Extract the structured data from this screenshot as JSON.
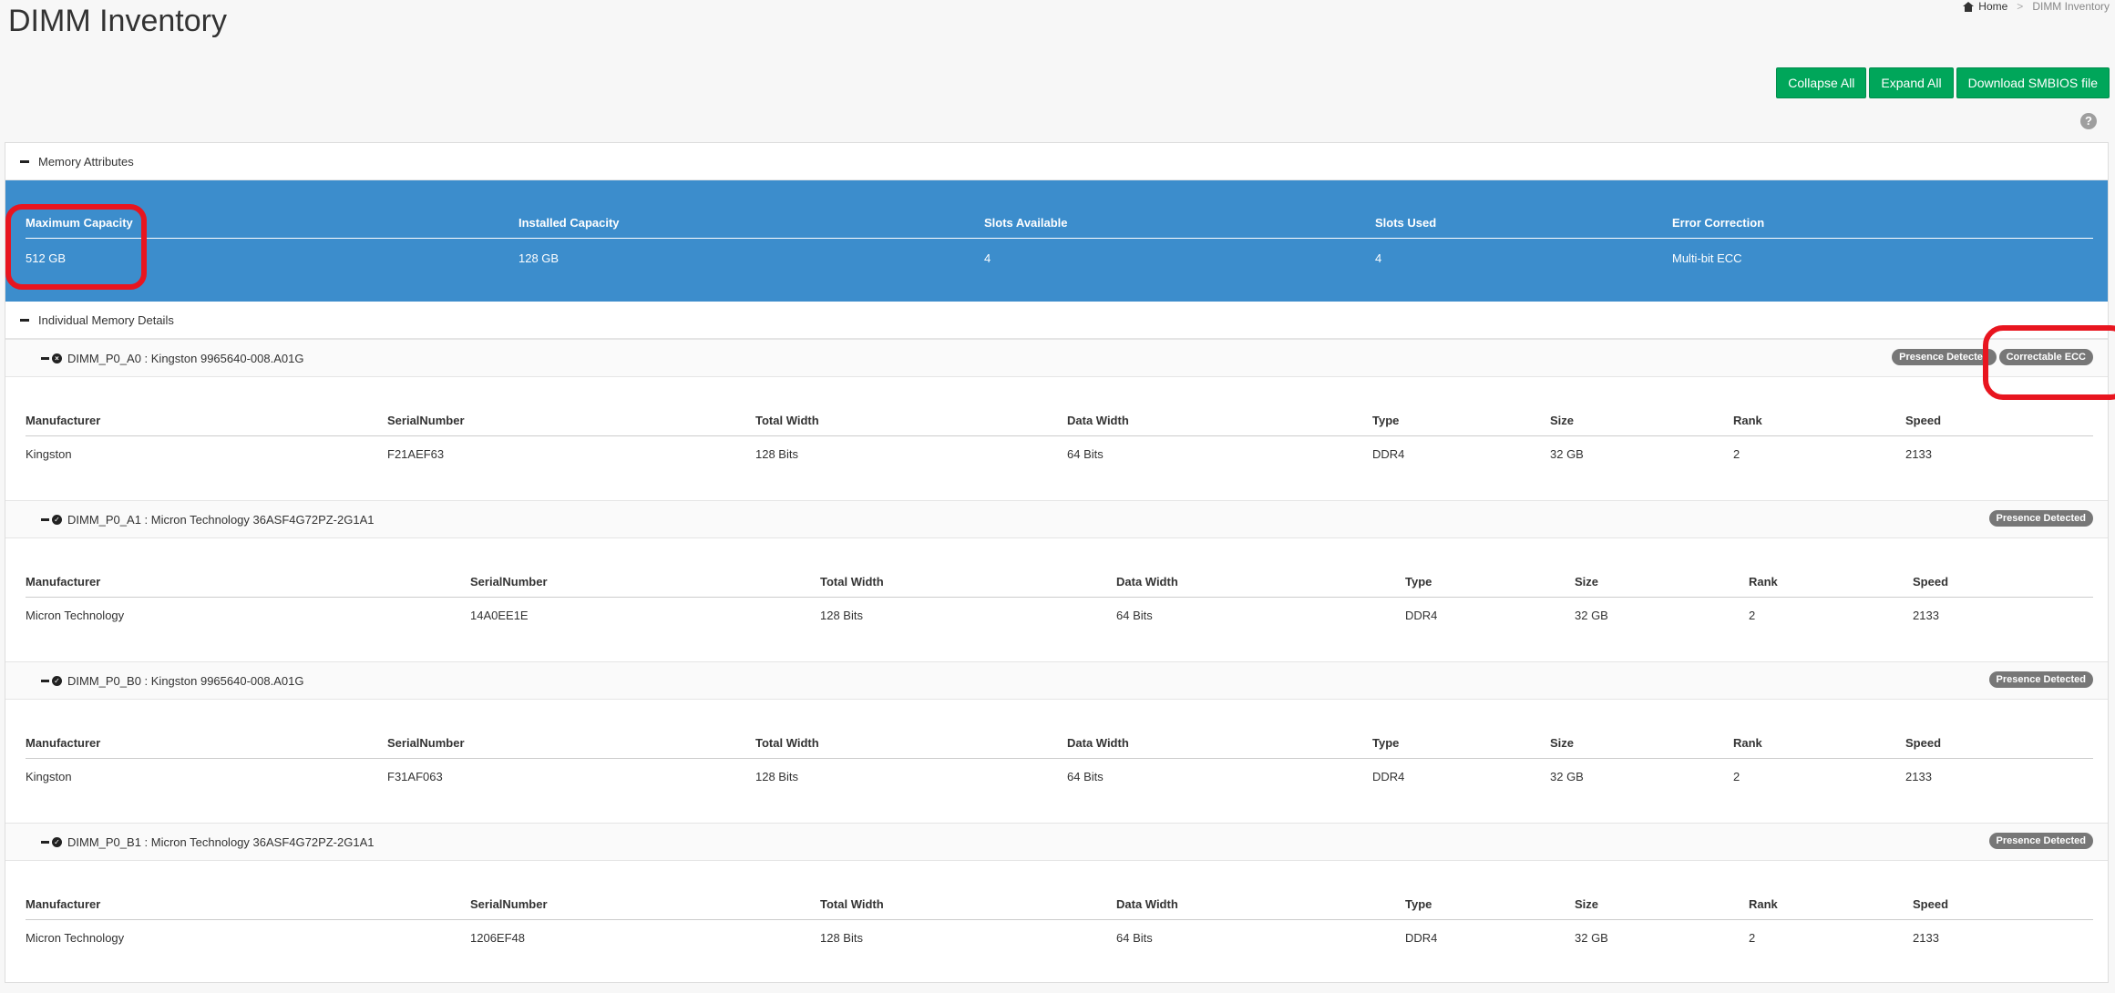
{
  "page": {
    "title": "DIMM Inventory"
  },
  "breadcrumb": {
    "home": "Home",
    "separator": ">",
    "current": "DIMM Inventory"
  },
  "toolbar": {
    "collapse_all": "Collapse All",
    "expand_all": "Expand All",
    "download_smbios": "Download SMBIOS file"
  },
  "help": {
    "glyph": "?"
  },
  "memory_attributes": {
    "title": "Memory Attributes",
    "headers": [
      "Maximum Capacity",
      "Installed Capacity",
      "Slots Available",
      "Slots Used",
      "Error Correction"
    ],
    "values": [
      "512 GB",
      "128 GB",
      "4",
      "4",
      "Multi-bit ECC"
    ]
  },
  "individual": {
    "title": "Individual Memory Details"
  },
  "dimm_headers": [
    "Manufacturer",
    "SerialNumber",
    "Total Width",
    "Data Width",
    "Type",
    "Size",
    "Rank",
    "Speed"
  ],
  "dimms": [
    {
      "label": "DIMM_P0_A0 : Kingston 9965640-008.A01G",
      "status_icon": "×",
      "badges": [
        "Presence Detected",
        "Correctable ECC"
      ],
      "values": [
        "Kingston",
        "F21AEF63",
        "128 Bits",
        "64 Bits",
        "DDR4",
        "32 GB",
        "2",
        "2133"
      ]
    },
    {
      "label": "DIMM_P0_A1 : Micron Technology 36ASF4G72PZ-2G1A1",
      "status_icon": "✓",
      "badges": [
        "Presence Detected"
      ],
      "values": [
        "Micron Technology",
        "14A0EE1E",
        "128 Bits",
        "64 Bits",
        "DDR4",
        "32 GB",
        "2",
        "2133"
      ]
    },
    {
      "label": "DIMM_P0_B0 : Kingston 9965640-008.A01G",
      "status_icon": "✓",
      "badges": [
        "Presence Detected"
      ],
      "values": [
        "Kingston",
        "F31AF063",
        "128 Bits",
        "64 Bits",
        "DDR4",
        "32 GB",
        "2",
        "2133"
      ]
    },
    {
      "label": "DIMM_P0_B1 : Micron Technology 36ASF4G72PZ-2G1A1",
      "status_icon": "✓",
      "badges": [
        "Presence Detected"
      ],
      "values": [
        "Micron Technology",
        "1206EF48",
        "128 Bits",
        "64 Bits",
        "DDR4",
        "32 GB",
        "2",
        "2133"
      ]
    }
  ],
  "colors": {
    "accent": "#3c8dcc",
    "button": "#00a65a",
    "badge": "#777777",
    "annotation": "#e8151f"
  }
}
